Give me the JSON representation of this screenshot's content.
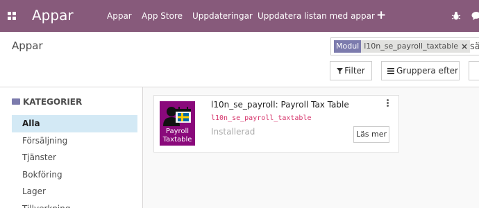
{
  "navbar": {
    "brand": "Appar",
    "menu": [
      {
        "label": "Appar"
      },
      {
        "label": "App Store"
      },
      {
        "label": "Uppdateringar"
      },
      {
        "label": "Uppdatera listan med appar"
      }
    ],
    "plus_icon": "plus-icon",
    "bug_icon": "bug-icon",
    "chat_icon": "chat-icon",
    "color": "#875a7b"
  },
  "control_panel": {
    "title": "Appar",
    "search": {
      "facet_label": "Modul",
      "facet_value": "l10n_se_payroll_taxtable",
      "input_value": "sä"
    },
    "filter_label": "Filter",
    "group_label": "Gruppera efter"
  },
  "sidebar": {
    "title": "KATEGORIER",
    "items": [
      {
        "label": "Alla",
        "active": true
      },
      {
        "label": "Försäljning"
      },
      {
        "label": "Tjänster"
      },
      {
        "label": "Bokföring"
      },
      {
        "label": "Lager"
      },
      {
        "label": "Tillverkning"
      }
    ]
  },
  "app_card": {
    "name": "l10n_se_payroll: Payroll Tax Table",
    "technical_name": "l10n_se_payroll_taxtable",
    "status": "Installerad",
    "learn_more": "Läs mer",
    "icon_text_line1": "Payroll",
    "icon_text_line2": "Taxtable",
    "icon_color": "#8a097b"
  }
}
